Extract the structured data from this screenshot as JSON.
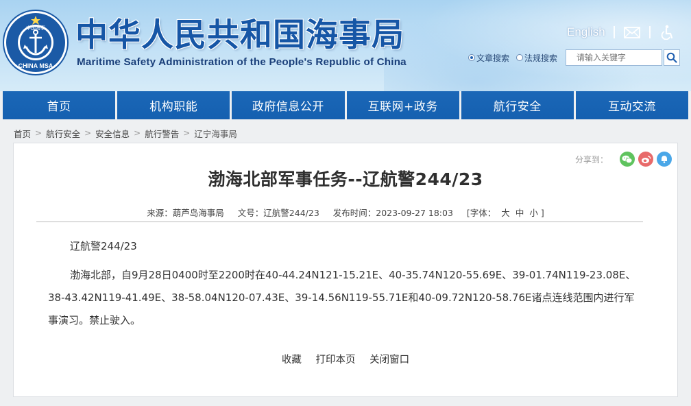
{
  "header": {
    "title": "中华人民共和国海事局",
    "subtitle": "Maritime Safety Administration of the People's Republic of China",
    "logo_text_top": "中国海事",
    "logo_text_bottom": "CHINA MSA",
    "english_link": "English",
    "search": {
      "options": [
        "文章搜索",
        "法规搜索"
      ],
      "selected": "文章搜索",
      "placeholder": "请输入关键字"
    }
  },
  "nav": {
    "items": [
      "首页",
      "机构职能",
      "政府信息公开",
      "互联网+政务",
      "航行安全",
      "互动交流"
    ]
  },
  "breadcrumb": [
    "首页",
    "航行安全",
    "安全信息",
    "航行警告",
    "辽宁海事局"
  ],
  "share": {
    "label": "分享到："
  },
  "article": {
    "title": "渤海北部军事任务--辽航警244/23",
    "source_label": "来源：",
    "source": "葫芦岛海事局",
    "doc_no_label": "文号：",
    "doc_no": "辽航警244/23",
    "pubtime_label": "发布时间：",
    "pubtime": "2023-09-27 18:03",
    "font_label_open": "[字体：",
    "font_sizes": [
      "大",
      "中",
      "小"
    ],
    "font_label_close": "]",
    "code": "辽航警244/23",
    "body": "渤海北部，自9月28日0400时至2200时在40-44.24N121-15.21E、40-35.74N120-55.69E、39-01.74N119-23.08E、38-43.42N119-41.49E、38-58.04N120-07.43E、39-14.56N119-55.71E和40-09.72N120-58.76E诸点连线范围内进行军事演习。禁止驶入。"
  },
  "actions": [
    "收藏",
    "打印本页",
    "关闭窗口"
  ],
  "colors": {
    "nav_blue": "#1560b0",
    "title_blue": "#1656a6",
    "wechat_green": "#5fc35e",
    "weibo_red": "#e86a6a",
    "qzone_blue": "#4aa7e8"
  }
}
